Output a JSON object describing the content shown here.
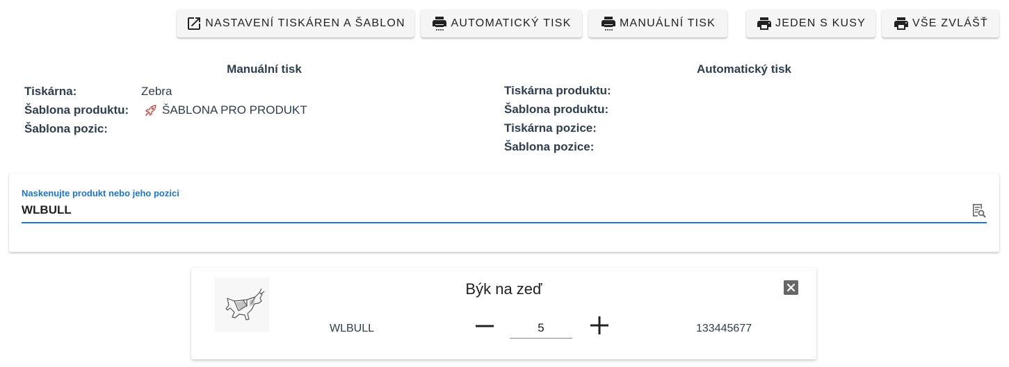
{
  "toolbar": {
    "settings_label": "NASTAVENÍ TISKÁREN A ŠABLON",
    "auto_print_label": "AUTOMATICKÝ TISK",
    "manual_print_label": "MANUÁLNÍ TISK",
    "one_with_pieces_label": "JEDEN S KUSY",
    "all_separately_label": "VŠE ZVLÁŠŤ"
  },
  "manual": {
    "title": "Manuální tisk",
    "printer_label": "Tiskárna:",
    "printer_value": "Zebra",
    "product_template_label": "Šablona produktu:",
    "product_template_value": "ŠABLONA PRO PRODUKT",
    "product_template_icon": "rocket-icon",
    "position_template_label": "Šablona pozic:"
  },
  "automatic": {
    "title": "Automatický tisk",
    "product_printer_label": "Tiskárna produktu:",
    "product_template_label": "Šablona produktu:",
    "position_printer_label": "Tiskárna pozice:",
    "position_template_label": "Šablona pozice:"
  },
  "scan": {
    "label": "Naskenujte produkt nebo jeho pozici",
    "value": "WLBULL",
    "icon": "search-list-icon"
  },
  "product": {
    "name": "Býk na zeď",
    "code": "WLBULL",
    "quantity": "5",
    "ean": "133445677"
  },
  "colors": {
    "accent": "#1976d2",
    "text": "#2c3e50",
    "button_bg": "#f5f5f5"
  }
}
